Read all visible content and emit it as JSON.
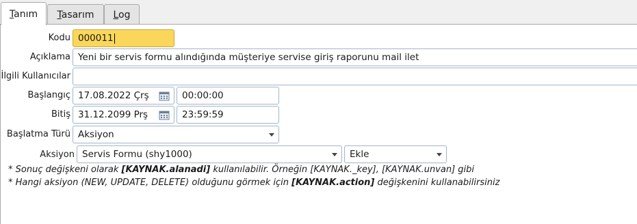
{
  "tabs": [
    {
      "key": "T",
      "rest": "anım"
    },
    {
      "key": "T",
      "rest": "asarım"
    },
    {
      "key": "L",
      "rest": "og"
    }
  ],
  "form": {
    "kodu_label": "Kodu",
    "kodu_value": "000011",
    "aciklama_label": "Açıklama",
    "aciklama_value": "Yeni bir servis formu alındığında müşteriye servise giriş raporunu mail ilet",
    "ilgili_label": "İlgili Kullanıcılar",
    "ilgili_value": "",
    "baslangic_label": "Başlangıç",
    "baslangic_date": "17.08.2022 Çrş",
    "baslangic_time": "00:00:00",
    "bitis_label": "Bitiş",
    "bitis_date": "31.12.2099 Prş",
    "bitis_time": "23:59:59",
    "baslatma_label": "Başlatma Türü",
    "baslatma_value": "Aksiyon",
    "aksiyon_label": "Aksiyon",
    "aksiyon_value": "Servis Formu (shy1000)",
    "aksiyon_mode": "Ekle"
  },
  "notes": {
    "line1_a": "* Sonuç değişkeni olarak ",
    "line1_b": "[KAYNAK.alanadi]",
    "line1_c": " kullanılabilir. Örneğin [KAYNAK._key], [KAYNAK.unvan] gibi",
    "line2_a": "* Hangi aksiyon (NEW, UPDATE, DELETE) olduğunu görmek için ",
    "line2_b": "[KAYNAK.action]",
    "line2_c": " değişkenini kullanabilirsiniz"
  },
  "colors": {
    "focus_field": "#fad75a",
    "field_border": "#a3b4c8"
  }
}
